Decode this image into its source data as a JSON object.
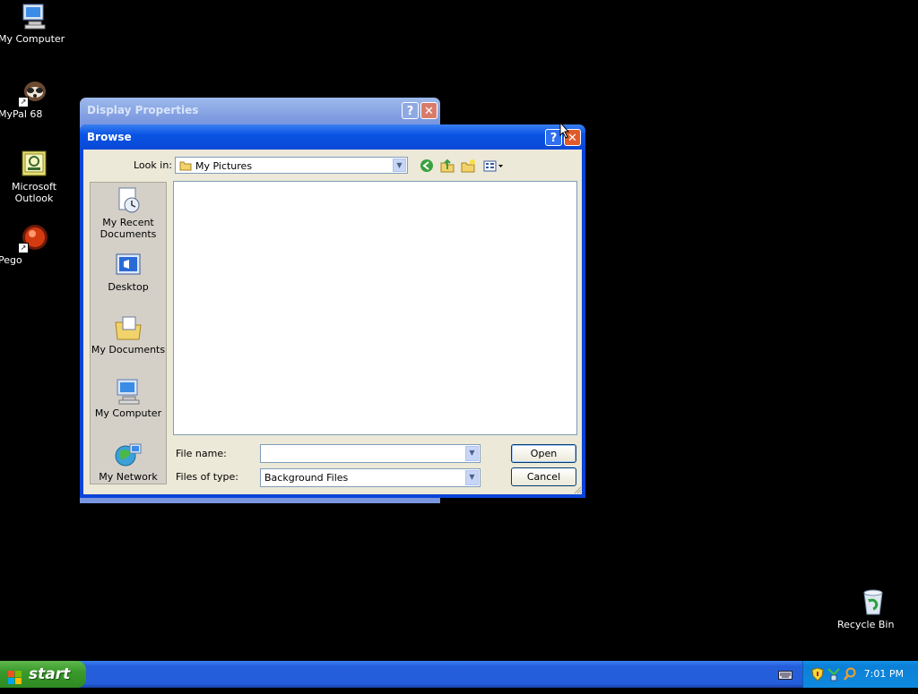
{
  "desktop": {
    "icons": [
      {
        "label": "My Computer",
        "icon": "my-computer-icon"
      },
      {
        "label": "MyPal 68",
        "icon": "mypal-icon"
      },
      {
        "label": "Microsoft Outlook",
        "icon": "outlook-icon"
      },
      {
        "label": "Pego",
        "icon": "pego-icon"
      },
      {
        "label": "Recycle Bin",
        "icon": "recycle-bin-icon"
      }
    ]
  },
  "display_properties": {
    "title": "Display Properties",
    "help_label": "?",
    "close_label": "✕"
  },
  "browse": {
    "title": "Browse",
    "help_label": "?",
    "close_label": "✕",
    "look_in_label": "Look in:",
    "look_in_value": "My Pictures",
    "places": [
      {
        "label": "My Recent Documents",
        "icon": "recent-documents-icon"
      },
      {
        "label": "Desktop",
        "icon": "desktop-icon"
      },
      {
        "label": "My Documents",
        "icon": "my-documents-icon"
      },
      {
        "label": "My Computer",
        "icon": "my-computer-icon"
      },
      {
        "label": "My Network",
        "icon": "my-network-icon"
      }
    ],
    "file_name_label": "File name:",
    "file_name_value": "",
    "files_of_type_label": "Files of type:",
    "files_of_type_value": "Background Files",
    "open_label": "Open",
    "cancel_label": "Cancel"
  },
  "taskbar": {
    "start_label": "start",
    "clock": "7:01 PM"
  }
}
